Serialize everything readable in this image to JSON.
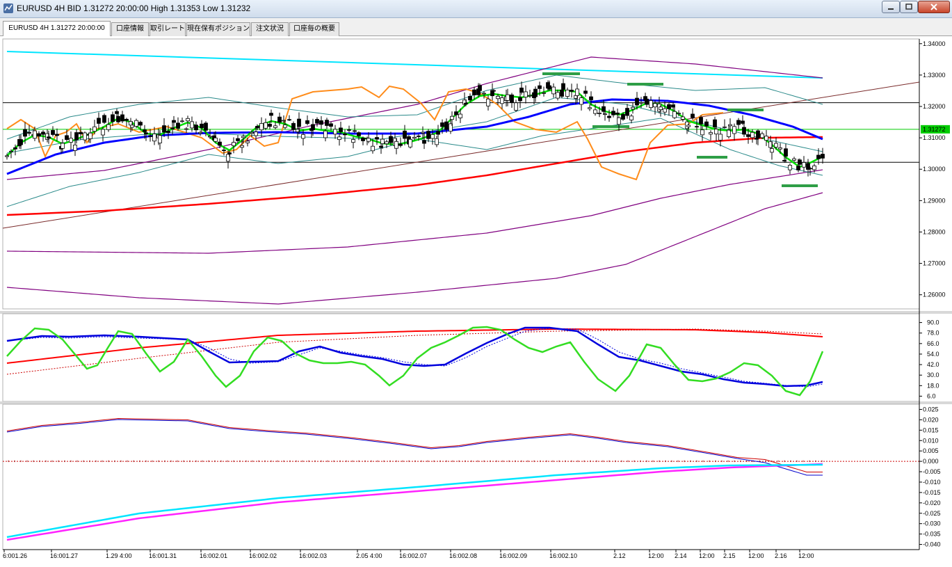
{
  "window": {
    "title": "EURUSD 4H BID 1.31272 20:00:00 High 1.31353 Low 1.31232"
  },
  "tabs": [
    {
      "label": "EURUSD 4H 1.31272 20:00:00",
      "active": true
    },
    {
      "label": "口座情報",
      "active": false
    },
    {
      "label": "取引レート",
      "active": false
    },
    {
      "label": "現在保有ポジション",
      "active": false
    },
    {
      "label": "注文状況",
      "active": false
    },
    {
      "label": "口座毎の概要",
      "active": false
    }
  ],
  "chart_data": [
    {
      "type": "candlestick",
      "symbol": "EURUSD",
      "timeframe": "4H",
      "current_price": "1.31272",
      "y_ticks": [
        "1.34000",
        "1.33000",
        "1.32000",
        "1.31000",
        "1.30000",
        "1.29000",
        "1.28000",
        "1.27000",
        "1.26000"
      ],
      "ylim": [
        1.2555,
        1.3415
      ],
      "horizontal_lines": [
        1.3212,
        1.3022
      ],
      "colors": {
        "up": "#000000",
        "down": "#000000",
        "ma_slow": "#ff0000",
        "ma_mid": "#0000ff",
        "ma_fast": "#00dd00",
        "osc": "#ff8800",
        "trend": "#00e5ff",
        "bands": "#800080",
        "support": "#2e9e46"
      }
    },
    {
      "type": "line",
      "name": "stochastic",
      "y_ticks": [
        "90.0",
        "78.0",
        "66.0",
        "54.0",
        "42.0",
        "30.0",
        "18.0",
        "6.0"
      ],
      "ylim": [
        0,
        100
      ]
    },
    {
      "type": "line",
      "name": "macd",
      "y_ticks": [
        "0.025",
        "0.020",
        "0.015",
        "0.010",
        "0.005",
        "0.000",
        "-0.005",
        "-0.010",
        "-0.015",
        "-0.020",
        "-0.025",
        "-0.030",
        "-0.035",
        "-0.040"
      ],
      "ylim": [
        -0.0425,
        0.0275
      ]
    }
  ],
  "x_axis": {
    "labels": [
      "6:001.26",
      "16:001.27",
      "1.29  4:00",
      "16:001.31",
      "16:002.01",
      "16:002.02",
      "16:002.03",
      "2.05  4:00",
      "16:002.07",
      "16:002.08",
      "16:002.09",
      "16:002.10",
      "2.12",
      "12:00",
      "2.14",
      "12:00",
      "2.15",
      "12:00",
      "2.16",
      "12:00"
    ]
  }
}
